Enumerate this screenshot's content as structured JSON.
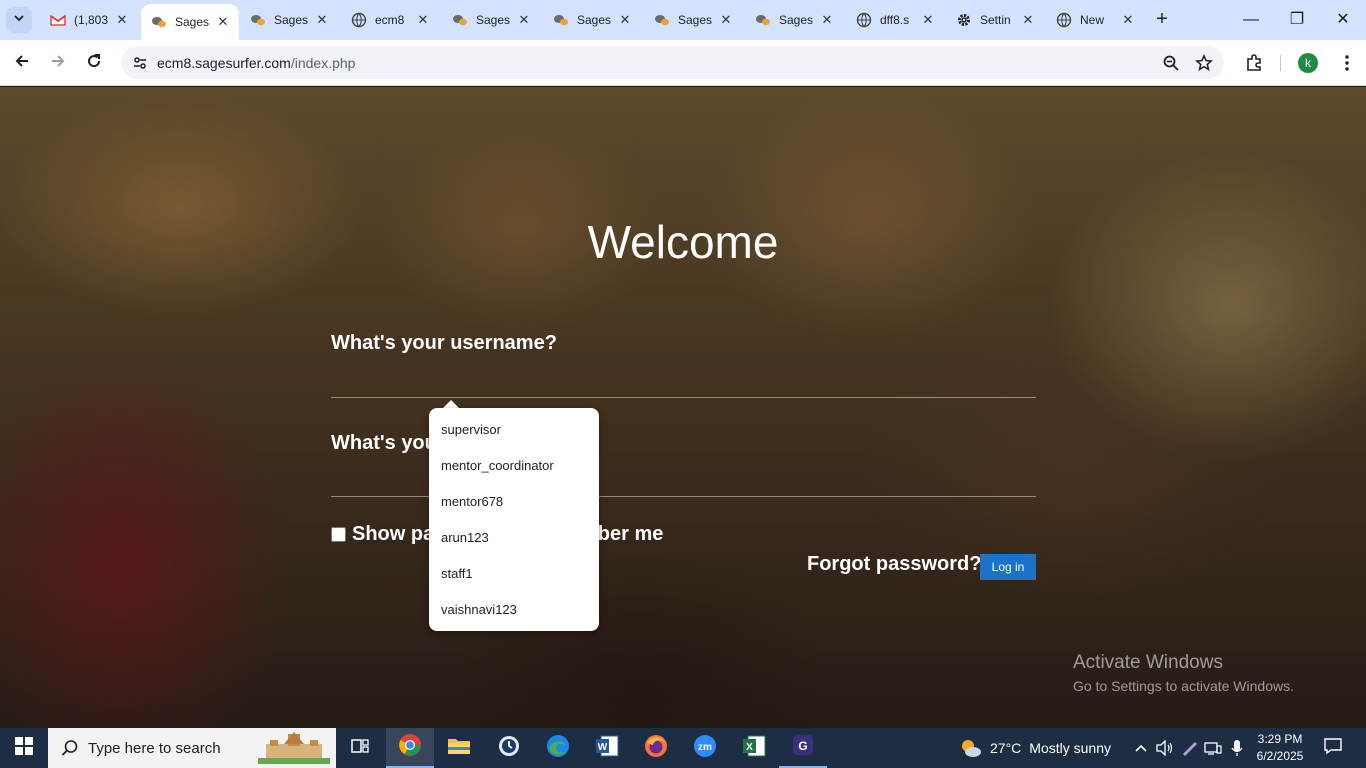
{
  "browser": {
    "tabs": [
      {
        "title": "(1,803",
        "icon": "gmail-icon"
      },
      {
        "title": "Sages",
        "icon": "sagesurfer-icon",
        "active": true
      },
      {
        "title": "Sages",
        "icon": "sagesurfer-icon"
      },
      {
        "title": "ecm8",
        "icon": "globe-icon"
      },
      {
        "title": "Sages",
        "icon": "sagesurfer-icon"
      },
      {
        "title": "Sages",
        "icon": "sagesurfer-icon"
      },
      {
        "title": "Sages",
        "icon": "sagesurfer-icon"
      },
      {
        "title": "Sages",
        "icon": "sagesurfer-icon"
      },
      {
        "title": "dff8.s",
        "icon": "globe-icon"
      },
      {
        "title": "Settin",
        "icon": "gear-icon"
      },
      {
        "title": "New",
        "icon": "globe-icon"
      }
    ],
    "url_host": "ecm8.sagesurfer.com",
    "url_path": "/index.php",
    "profile_initial": "k"
  },
  "login": {
    "heading": "Welcome",
    "username_label": "What's your username?",
    "password_label_visible": "What's your",
    "show_password_visible": "Show pas",
    "remember_visible": "mber me",
    "forgot": "Forgot password?",
    "login_button": "Log in"
  },
  "autofill": {
    "items": [
      "supervisor",
      "mentor_coordinator",
      "mentor678",
      "arun123",
      "staff1",
      "vaishnavi123"
    ]
  },
  "watermark": {
    "title": "Activate Windows",
    "subtitle": "Go to Settings to activate Windows."
  },
  "taskbar": {
    "search_placeholder": "Type here to search",
    "weather_temp": "27°C",
    "weather_text": "Mostly sunny",
    "time": "3:29 PM",
    "date": "6/2/2025"
  }
}
